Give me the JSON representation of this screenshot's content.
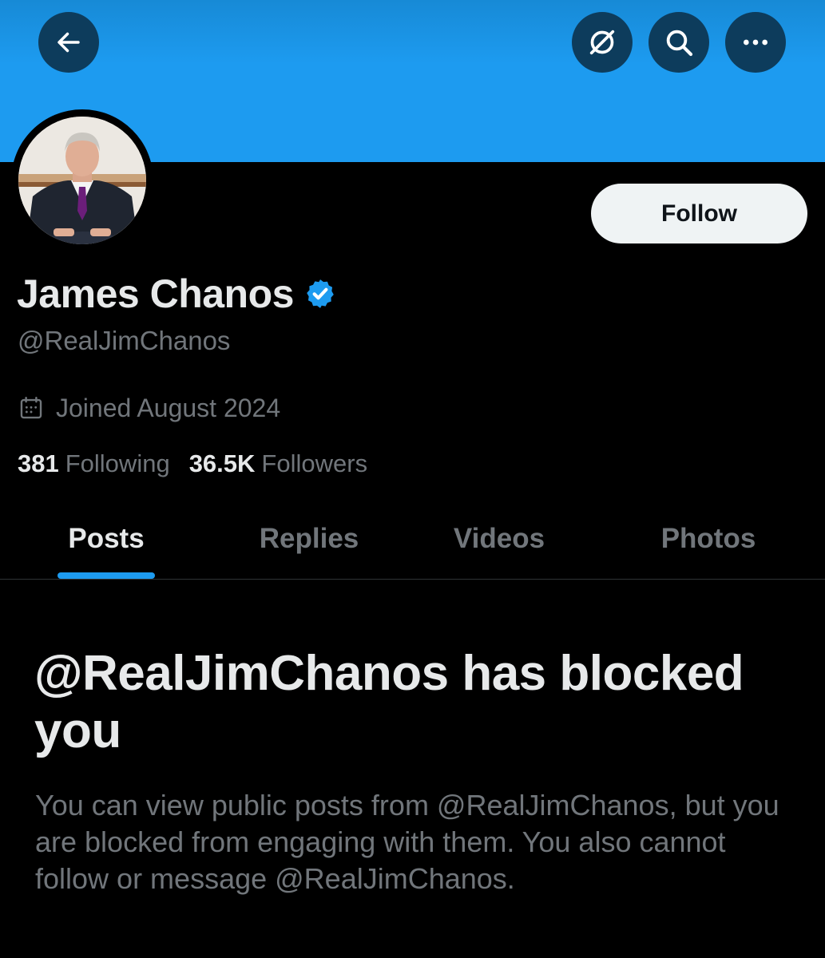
{
  "header": {
    "back_icon": "arrow-left-icon",
    "grok_icon": "grok-icon",
    "search_icon": "search-icon",
    "more_icon": "more-horizontal-icon",
    "banner_color": "#1d9bf0"
  },
  "profile": {
    "avatar_icon": "avatar",
    "follow_label": "Follow",
    "display_name": "James Chanos",
    "verified_icon": "verified-badge-icon",
    "handle": "@RealJimChanos",
    "joined_icon": "calendar-icon",
    "joined": "Joined August 2024",
    "following_count": "381",
    "following_label": "Following",
    "followers_count": "36.5K",
    "followers_label": "Followers"
  },
  "tabs": [
    {
      "label": "Posts",
      "active": true
    },
    {
      "label": "Replies",
      "active": false
    },
    {
      "label": "Videos",
      "active": false
    },
    {
      "label": "Photos",
      "active": false
    }
  ],
  "blocked": {
    "title": "@RealJimChanos has blocked you",
    "body": "You can view public posts from @RealJimChanos, but you are blocked from engaging with them. You also cannot follow or message @RealJimChanos."
  },
  "colors": {
    "accent": "#1d9bf0",
    "background": "#000000",
    "text_primary": "#e7e9ea",
    "text_secondary": "#71767b"
  }
}
